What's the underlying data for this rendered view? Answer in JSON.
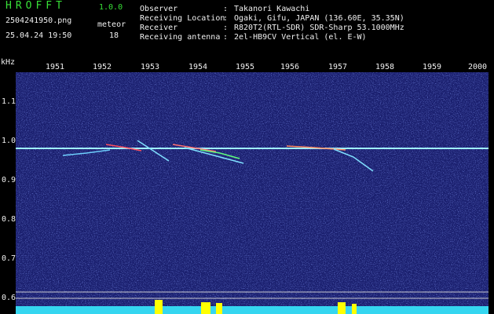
{
  "app": {
    "title": "HROFFT",
    "version": "1.0.0"
  },
  "file": {
    "name": "2504241950.png",
    "datetime": "25.04.24 19:50"
  },
  "meteor": {
    "label": "meteor",
    "count": "18"
  },
  "info": {
    "observer_key": "Observer",
    "observer_val": "Takanori Kawachi",
    "location_key": "Receiving Location",
    "location_val": "Ogaki, Gifu, JAPAN (136.60E, 35.35N)",
    "receiver_key": "Receiver",
    "receiver_val": "R820T2(RTL-SDR) SDR-Sharp 53.1000MHz",
    "antenna_key": "Receiving antenna",
    "antenna_val": "2el-HB9CV Vertical (el. E-W)",
    "sep": ":"
  },
  "axis": {
    "unit": "kHz",
    "time_ticks": [
      "1951",
      "1952",
      "1953",
      "1954",
      "1955",
      "1956",
      "1957",
      "1958",
      "1959",
      "2000"
    ],
    "freq_ticks": [
      "1.1",
      "1.0",
      "0.9",
      "0.8",
      "0.7",
      "0.6"
    ]
  },
  "colors": {
    "background": "#1a1f6e",
    "text_green": "#38e038",
    "carrier": "#9ff0ff",
    "activity": "#ffff00"
  }
}
